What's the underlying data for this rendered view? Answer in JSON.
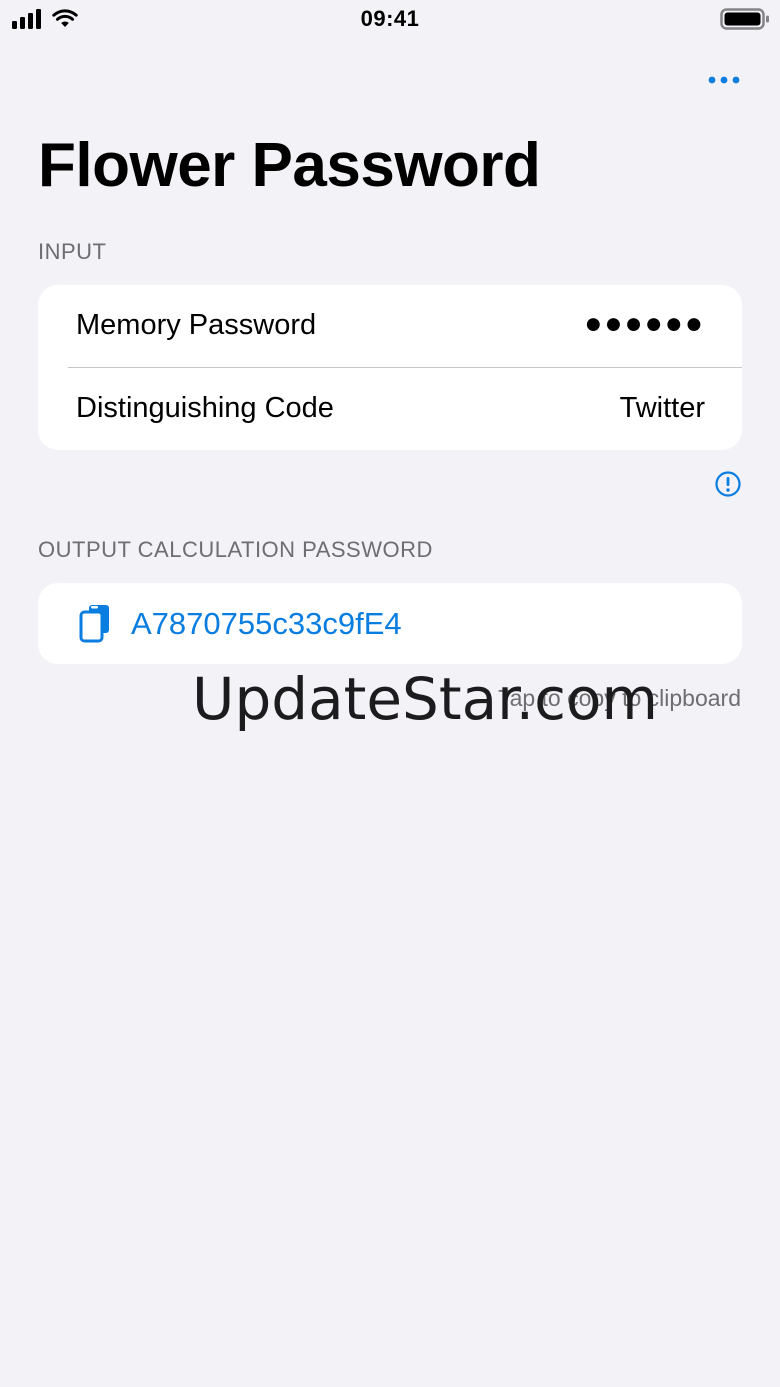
{
  "status_bar": {
    "time": "09:41",
    "icons": [
      "cellular-signal-icon",
      "wifi-icon",
      "battery-icon"
    ]
  },
  "toolbar": {
    "more_icon": "ellipsis-icon"
  },
  "page": {
    "title": "Flower Password"
  },
  "input_section": {
    "header": "INPUT",
    "rows": [
      {
        "label": "Memory Password",
        "value": "●●●●●●"
      },
      {
        "label": "Distinguishing Code",
        "value": "Twitter"
      }
    ],
    "info_icon": "exclamation-circle-icon"
  },
  "output_section": {
    "header": "OUTPUT CALCULATION PASSWORD",
    "icon": "copy-clipboard-icon",
    "value": "A7870755c33c9fE4",
    "hint": "Tap to copy to clipboard"
  },
  "watermark": "UpdateStar.com",
  "colors": {
    "background": "#f2f2f7",
    "card": "#ffffff",
    "accent": "#0a7ee0",
    "secondary_text": "#6d6d72",
    "separator": "#c6c6c8"
  }
}
